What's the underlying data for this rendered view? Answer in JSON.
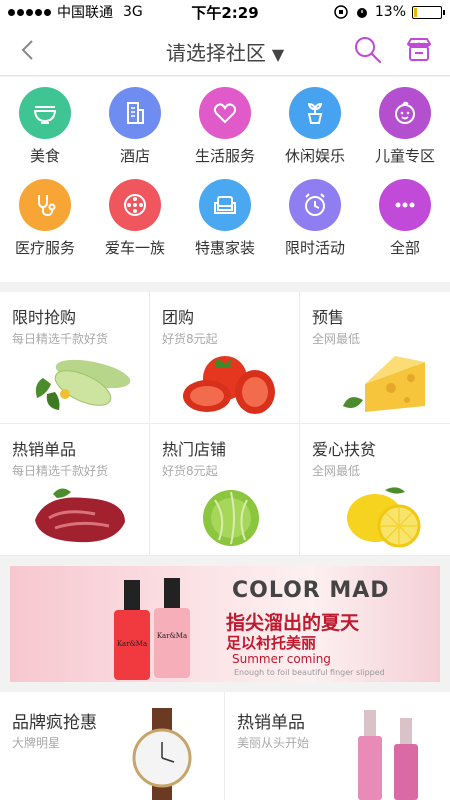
{
  "status_bar": {
    "carrier": "中国联通",
    "network": "3G",
    "time": "下午2:29",
    "battery_percent": "13%",
    "battery_level": 0.13
  },
  "nav": {
    "title": "请选择社区",
    "caret": "▼",
    "back_icon": "chevron-left-icon",
    "search_icon": "search-icon",
    "store_icon": "store-icon"
  },
  "categories": [
    {
      "label": "美食",
      "icon": "bowl-icon",
      "color": "#3fc593"
    },
    {
      "label": "酒店",
      "icon": "building-icon",
      "color": "#6f8df1"
    },
    {
      "label": "生活服务",
      "icon": "heart-icon",
      "color": "#e05ac9"
    },
    {
      "label": "休闲娱乐",
      "icon": "plant-icon",
      "color": "#47a3ef"
    },
    {
      "label": "儿童专区",
      "icon": "baby-face-icon",
      "color": "#b44fd0"
    },
    {
      "label": "医疗服务",
      "icon": "stethoscope-icon",
      "color": "#f7a535"
    },
    {
      "label": "爱车一族",
      "icon": "wheel-icon",
      "color": "#f0565e"
    },
    {
      "label": "特惠家装",
      "icon": "sofa-icon",
      "color": "#4aa8f0"
    },
    {
      "label": "限时活动",
      "icon": "alarm-clock-icon",
      "color": "#8f7ef2"
    },
    {
      "label": "全部",
      "icon": "more-dots-icon",
      "color": "#c24ad8"
    }
  ],
  "grid": [
    {
      "title": "限时抢购",
      "subtitle": "每日精选千款好货",
      "image": "zucchini-image"
    },
    {
      "title": "团购",
      "subtitle": "好货8元起",
      "image": "tomato-image"
    },
    {
      "title": "预售",
      "subtitle": "全网最低",
      "image": "cheese-image"
    },
    {
      "title": "热销单品",
      "subtitle": "每日精选千款好货",
      "image": "beef-image"
    },
    {
      "title": "热门店铺",
      "subtitle": "好货8元起",
      "image": "cabbage-image"
    },
    {
      "title": "爱心扶贫",
      "subtitle": "全网最低",
      "image": "lemon-image"
    }
  ],
  "banner": {
    "brand": "COLOR MAD",
    "line1": "指尖溜出的夏天",
    "line2": "足以衬托美丽",
    "line3": "Summer coming",
    "line4": "Enough to foil beautiful finger slipped",
    "bottle_label": "Kar&Ma"
  },
  "promo": [
    {
      "title": "品牌疯抢惠",
      "subtitle": "大牌明星",
      "image": "watch-image"
    },
    {
      "title": "热销单品",
      "subtitle": "美丽从头开始",
      "image": "cosmetics-bottles-image"
    }
  ]
}
